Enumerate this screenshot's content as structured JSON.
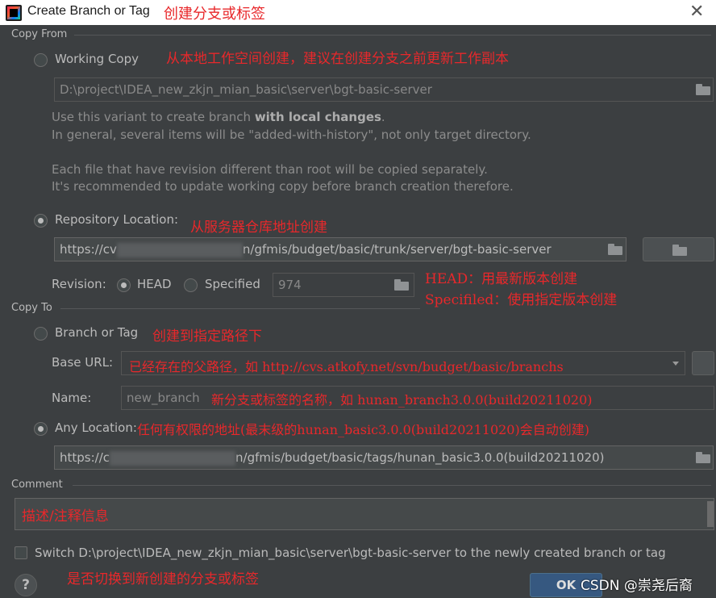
{
  "dialog": {
    "title": "Create Branch or Tag",
    "title_note": "创建分支或标签"
  },
  "copy_from": {
    "section_label": "Copy From",
    "working_copy": {
      "label": "Working Copy",
      "note": "从本地工作空间创建，建议在创建分支之前更新工作副本",
      "path": "D:\\project\\IDEA_new_zkjn_mian_basic\\server\\bgt-basic-server",
      "hint_line1_pre": "Use this variant to create branch ",
      "hint_line1_bold": "with local changes",
      "hint_line1_post": ".",
      "hint_line2": "In general, several items will be \"added-with-history\", not only target directory.",
      "hint_line3": "Each file that have revision different than root will be copied separately.",
      "hint_line4": "It's recommended to update working copy before branch creation therefore."
    },
    "repository_location": {
      "label": "Repository Location:",
      "note": "从服务器仓库地址创建",
      "url_prefix": "https://cv",
      "url_suffix": "n/gfmis/budget/basic/trunk/server/bgt-basic-server"
    },
    "revision": {
      "label": "Revision:",
      "head_label": "HEAD",
      "specified_label": "Specified",
      "specified_value": "974",
      "note_head": "HEAD：用最新版本创建",
      "note_specified": "Specifiled：使用指定版本创建"
    }
  },
  "copy_to": {
    "section_label": "Copy To",
    "branch_or_tag": {
      "label": "Branch or Tag",
      "note": "创建到指定路径下"
    },
    "base_url": {
      "label": "Base URL:",
      "note": "已经存在的父路径，如 http://cvs.atkofy.net/svn/budget/basic/branchs"
    },
    "name": {
      "label": "Name:",
      "value": "new_branch",
      "note": "新分支或标签的名称，如 hunan_branch3.0.0(build20211020)"
    },
    "any_location": {
      "label": "Any Location:",
      "note": "任何有权限的地址(最末级的hunan_basic3.0.0(build20211020)会自动创建)",
      "url_prefix": "https://c",
      "url_suffix": "n/gfmis/budget/basic/tags/hunan_basic3.0.0(build20211020)"
    }
  },
  "comment": {
    "section_label": "Comment",
    "value": "描述/注释信息"
  },
  "switch": {
    "label": "Switch D:\\project\\IDEA_new_zkjn_mian_basic\\server\\bgt-basic-server to the newly created branch or tag",
    "note": "是否切换到新创建的分支或标签"
  },
  "footer": {
    "help": "?",
    "ok_label": "OK",
    "watermark": "CSDN @崇尧后裔"
  }
}
